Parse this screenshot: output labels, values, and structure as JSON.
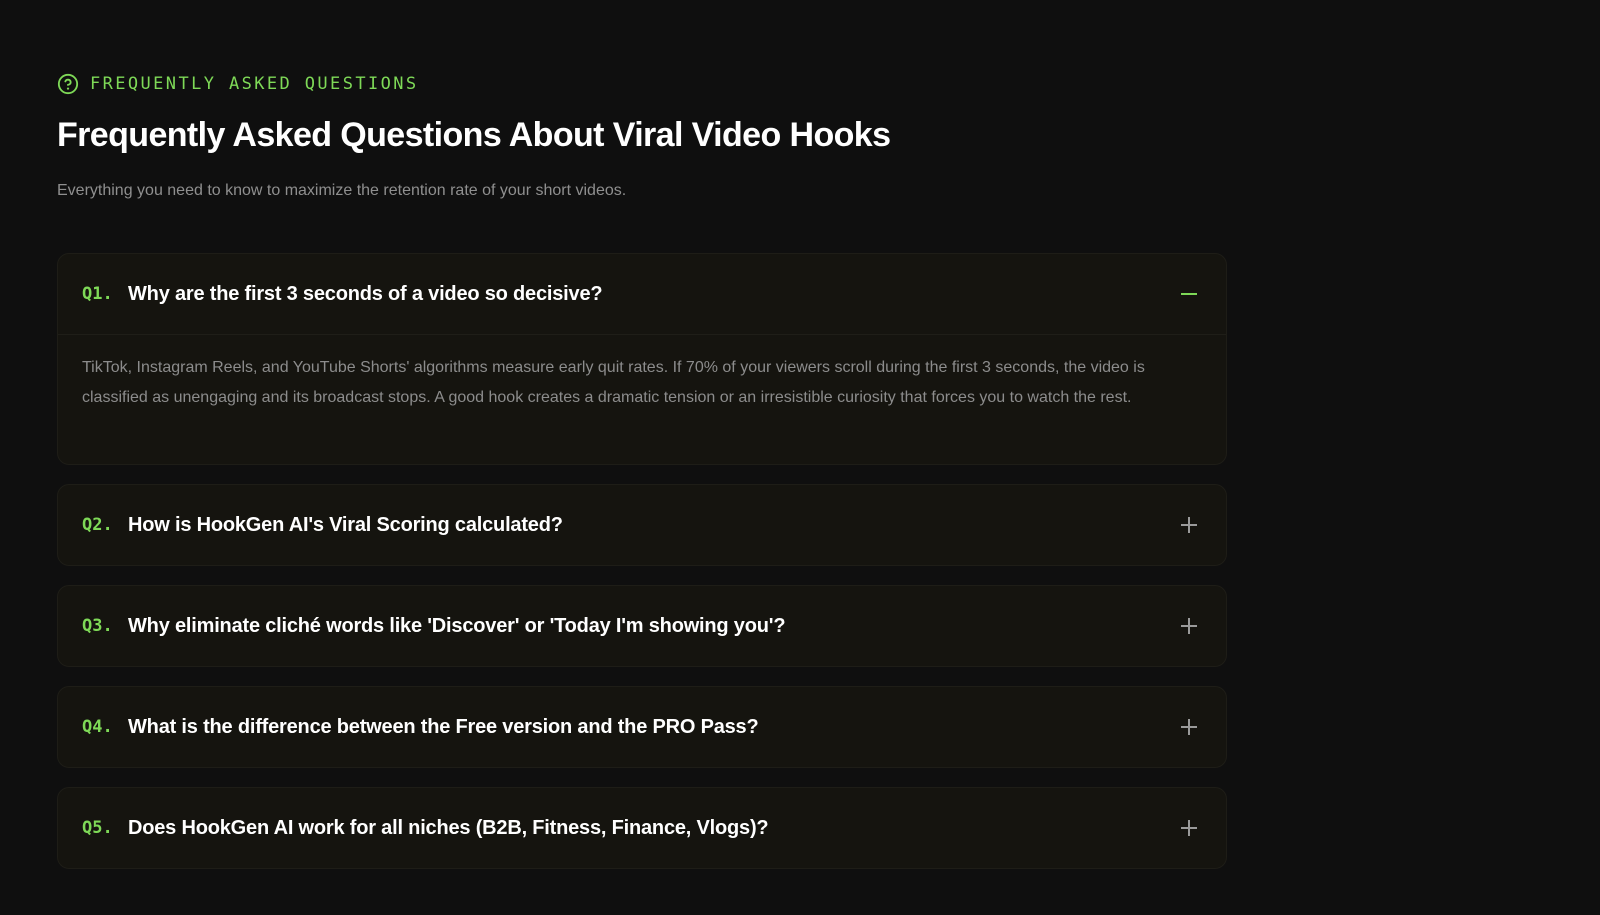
{
  "eyebrow": {
    "icon": "question-circle-icon",
    "label": "FREQUENTLY ASKED QUESTIONS"
  },
  "heading": "Frequently Asked Questions About Viral Video Hooks",
  "subtitle": "Everything you need to know to maximize the retention rate of your short videos.",
  "accent_color": "#7ed957",
  "faq": [
    {
      "num": "Q1.",
      "question": "Why are the first 3 seconds of a video so decisive?",
      "expanded": true,
      "toggle_icon": "minus-icon",
      "answer": "TikTok, Instagram Reels, and YouTube Shorts' algorithms measure early quit rates. If 70% of your viewers scroll during the first 3 seconds, the video is classified as unengaging and its broadcast stops. A good hook creates a dramatic tension or an irresistible curiosity that forces you to watch the rest."
    },
    {
      "num": "Q2.",
      "question": "How is HookGen AI's Viral Scoring calculated?",
      "expanded": false,
      "toggle_icon": "plus-icon"
    },
    {
      "num": "Q3.",
      "question": "Why eliminate cliché words like 'Discover' or 'Today I'm showing you'?",
      "expanded": false,
      "toggle_icon": "plus-icon"
    },
    {
      "num": "Q4.",
      "question": "What is the difference between the Free version and the PRO Pass?",
      "expanded": false,
      "toggle_icon": "plus-icon"
    },
    {
      "num": "Q5.",
      "question": "Does HookGen AI work for all niches (B2B, Fitness, Finance, Vlogs)?",
      "expanded": false,
      "toggle_icon": "plus-icon"
    }
  ]
}
